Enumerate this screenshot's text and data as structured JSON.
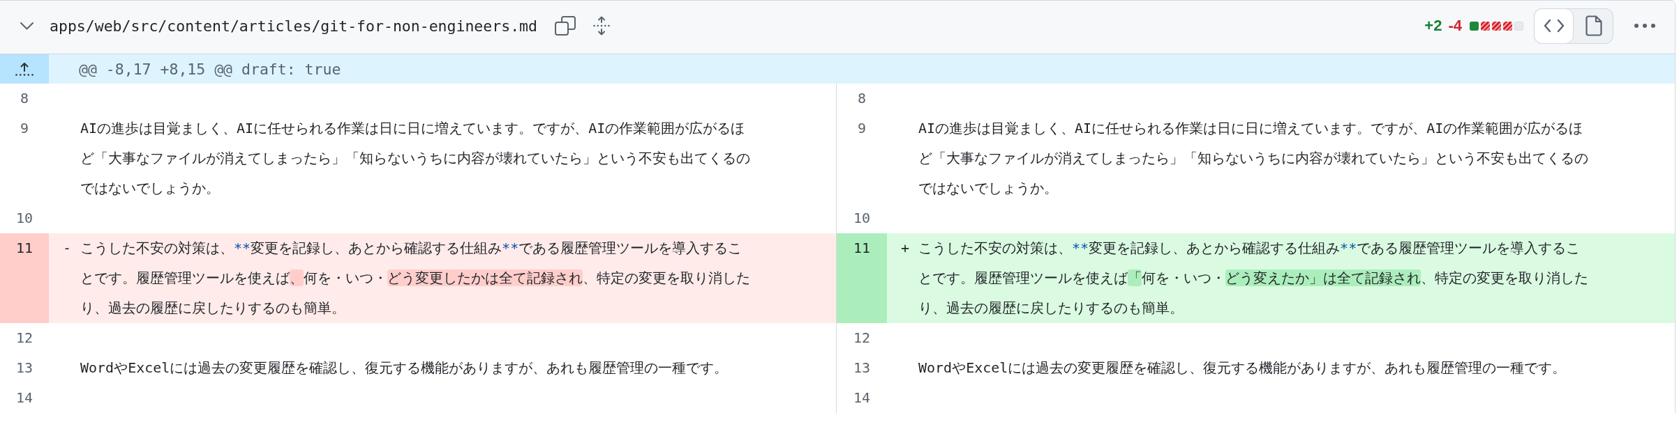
{
  "file": {
    "expanded": true,
    "path": "apps/web/src/content/articles/git-for-non-engineers.md",
    "additions": "+2",
    "deletions": "-4",
    "diffstat": [
      {
        "kind": "added"
      },
      {
        "kind": "deleted"
      },
      {
        "kind": "deleted"
      },
      {
        "kind": "deleted"
      },
      {
        "kind": "neutral"
      }
    ],
    "views": [
      {
        "kind": "source",
        "selected": true
      },
      {
        "kind": "rich",
        "selected": false
      }
    ]
  },
  "hunk": {
    "header": "@@ -8,17 +8,15 @@ draft: true"
  },
  "rows": [
    {
      "left": {
        "kind": "context",
        "number": "8"
      },
      "right": {
        "kind": "context",
        "number": "8"
      }
    },
    {
      "left": {
        "kind": "context",
        "number": "9",
        "segments": [
          {
            "kind": "plain",
            "text": "AIの進歩は目覚ましく、AIに任せられる作業は日に日に増えています。ですが、AIの作業範囲が広がるほど「大事なファイルが消えてしまったら」「知らないうちに内容が壊れていたら」という不安も出てくるのではないでしょうか。"
          }
        ]
      },
      "right": {
        "kind": "context",
        "number": "9",
        "segments": [
          {
            "kind": "plain",
            "text": "AIの進歩は目覚ましく、AIに任せられる作業は日に日に増えています。ですが、AIの作業範囲が広がるほど「大事なファイルが消えてしまったら」「知らないうちに内容が壊れていたら」という不安も出てくるのではないでしょうか。"
          }
        ]
      }
    },
    {
      "left": {
        "kind": "context",
        "number": "10"
      },
      "right": {
        "kind": "context",
        "number": "10"
      }
    },
    {
      "left": {
        "kind": "deleted",
        "number": "11",
        "marker": "-",
        "segments": [
          {
            "kind": "plain",
            "text": "こうした不安の対策は、"
          },
          {
            "kind": "syntax",
            "text": "**"
          },
          {
            "kind": "plain",
            "text": "変更を記録し、あとから確認する仕組み"
          },
          {
            "kind": "syntax",
            "text": "**"
          },
          {
            "kind": "plain",
            "text": "である履歴管理ツールを導入することです。履歴管理ツールを使えば"
          },
          {
            "kind": "changed",
            "text": "、"
          },
          {
            "kind": "plain",
            "text": "何を・いつ・"
          },
          {
            "kind": "changed",
            "text": "どう変更したかは全て記録され"
          },
          {
            "kind": "plain",
            "text": "、特定の変更を取り消したり、過去の履歴に戻したりするのも簡単。"
          }
        ]
      },
      "right": {
        "kind": "added",
        "number": "11",
        "marker": "+",
        "segments": [
          {
            "kind": "plain",
            "text": "こうした不安の対策は、"
          },
          {
            "kind": "syntax",
            "text": "**"
          },
          {
            "kind": "plain",
            "text": "変更を記録し、あとから確認する仕組み"
          },
          {
            "kind": "syntax",
            "text": "**"
          },
          {
            "kind": "plain",
            "text": "である履歴管理ツールを導入することです。履歴管理ツールを使えば"
          },
          {
            "kind": "changed",
            "text": "「"
          },
          {
            "kind": "plain",
            "text": "何を・いつ・"
          },
          {
            "kind": "changed",
            "text": "どう変えたか」は全て記録され"
          },
          {
            "kind": "plain",
            "text": "、特定の変更を取り消したり、過去の履歴に戻したりするのも簡単。"
          }
        ]
      }
    },
    {
      "left": {
        "kind": "context",
        "number": "12"
      },
      "right": {
        "kind": "context",
        "number": "12"
      }
    },
    {
      "left": {
        "kind": "context",
        "number": "13",
        "segments": [
          {
            "kind": "plain",
            "text": "WordやExcelには過去の変更履歴を確認し、復元する機能がありますが、あれも履歴管理の一種です。"
          }
        ]
      },
      "right": {
        "kind": "context",
        "number": "13",
        "segments": [
          {
            "kind": "plain",
            "text": "WordやExcelには過去の変更履歴を確認し、復元する機能がありますが、あれも履歴管理の一種です。"
          }
        ]
      }
    },
    {
      "left": {
        "kind": "context",
        "number": "14"
      },
      "right": {
        "kind": "context",
        "number": "14"
      }
    }
  ]
}
